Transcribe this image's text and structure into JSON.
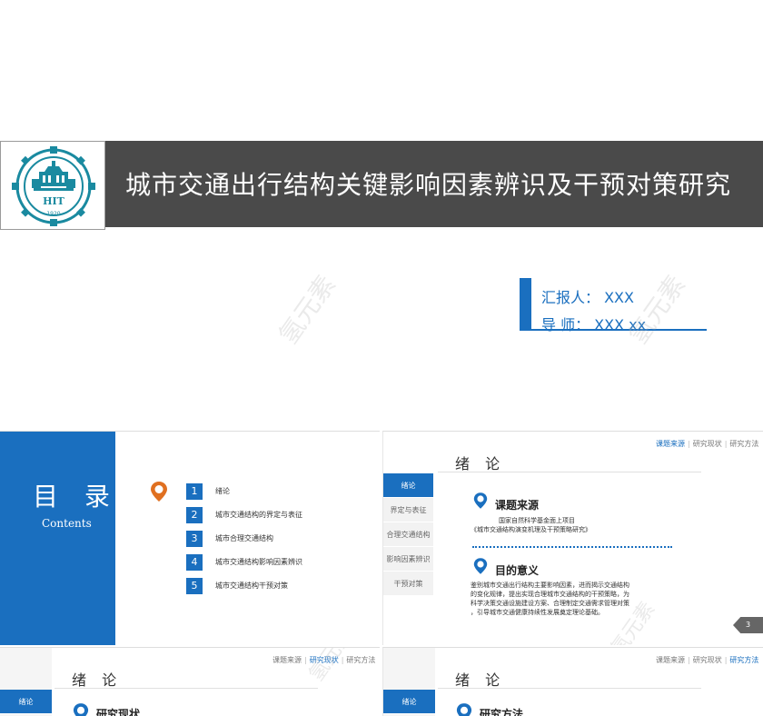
{
  "cover": {
    "title": "城市交通出行结构关键影响因素辨识及干预对策研究",
    "logo": {
      "text": "HIT",
      "year": "1920"
    },
    "reporter": "汇报人： XXX",
    "advisor": "导  师： XXX xx",
    "watermark": "氢元素"
  },
  "toc_slide": {
    "title": "目 录",
    "subtitle": "Contents",
    "items": [
      {
        "num": "1",
        "label": "绪论"
      },
      {
        "num": "2",
        "label": "城市交通结构的界定与表征"
      },
      {
        "num": "3",
        "label": "城市合理交通结构"
      },
      {
        "num": "4",
        "label": "城市交通结构影响因素辨识"
      },
      {
        "num": "5",
        "label": "城市交通结构干预对策"
      }
    ]
  },
  "intro_slide": {
    "nav": [
      "课题来源",
      "研究现状",
      "研究方法"
    ],
    "heading": "绪 论",
    "side_nav": [
      "绪论",
      "界定与表征",
      "合理交通结构",
      "影响因素辨识",
      "干预对策"
    ],
    "section1": {
      "title": "课题来源",
      "line1": "国家自然科学基金面上项目",
      "line2": "《城市交通结构演变机理及干预策略研究》"
    },
    "section2": {
      "title": "目的意义",
      "lines": [
        "鉴别城市交通出行结构主要影响因素，进而揭示交通结构",
        "的变化规律，提出实现合理城市交通结构的干预策略，为",
        "科学决策交通设施建设方案、合理制定交通需求管理对策",
        "，引导城市交通健康持续性发展奠定理论基础。"
      ]
    },
    "page_number": "3"
  },
  "status_slide": {
    "nav": [
      "课题来源",
      "研究现状",
      "研究方法"
    ],
    "heading": "绪 论",
    "side_active": "绪论",
    "section_title": "研究现状"
  },
  "method_slide": {
    "nav": [
      "课题来源",
      "研究现状",
      "研究方法"
    ],
    "heading": "绪 论",
    "side_active": "绪论",
    "section_title": "研究方法"
  },
  "colors": {
    "accent": "#1a6fbf",
    "band": "#4a4a4a",
    "pin": "#e07020"
  }
}
